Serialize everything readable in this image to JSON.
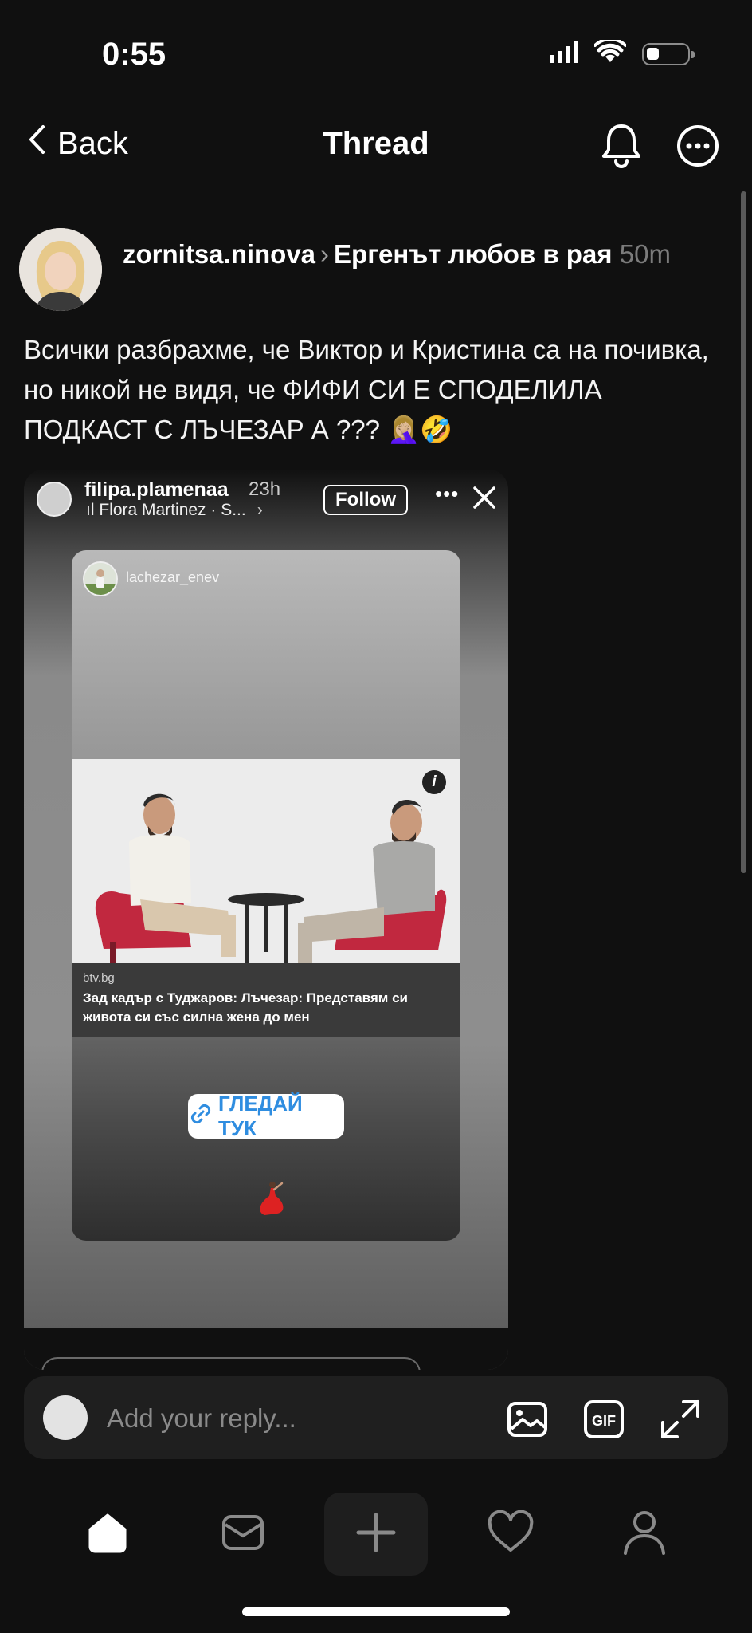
{
  "status": {
    "time": "0:55"
  },
  "header": {
    "back_label": "Back",
    "title": "Thread"
  },
  "post": {
    "author": "zornitsa.ninova",
    "community": "Ергенът любов в рая",
    "time_ago": "50m",
    "text": "Всички разбрахме, че Виктор и Кристина са на почивка, но никой не видя, че ФИФИ СИ Е СПОДЕЛИЛА ПОДКАСТ С ЛЪЧЕЗАР А ??? 🤦🏼‍♀️🤣"
  },
  "story": {
    "username": "filipa.plamenaa",
    "time_ago": "23h",
    "music": "Flora Martinez · S...",
    "follow_label": "Follow",
    "inner_username": "lachezar_enev",
    "link_domain": "btv.bg",
    "link_title": "Зад кадър с Туджаров: Лъчезар: Представям си живота си със силна жена до мен",
    "button_label": "ГЛЕДАЙ ТУК"
  },
  "reply": {
    "placeholder": "Add your reply..."
  },
  "icons": {
    "status": [
      "signal-icon",
      "wifi-icon",
      "battery-icon"
    ],
    "header": [
      "chevron-left-icon",
      "bell-icon",
      "more-icon"
    ],
    "reply": [
      "image-icon",
      "gif-icon",
      "expand-icon"
    ],
    "tabs": [
      "home-icon",
      "inbox-icon",
      "plus-icon",
      "heart-icon",
      "profile-icon"
    ]
  },
  "colors": {
    "background": "#101010",
    "link": "#2f8de0",
    "muted": "#7b7b7b"
  }
}
